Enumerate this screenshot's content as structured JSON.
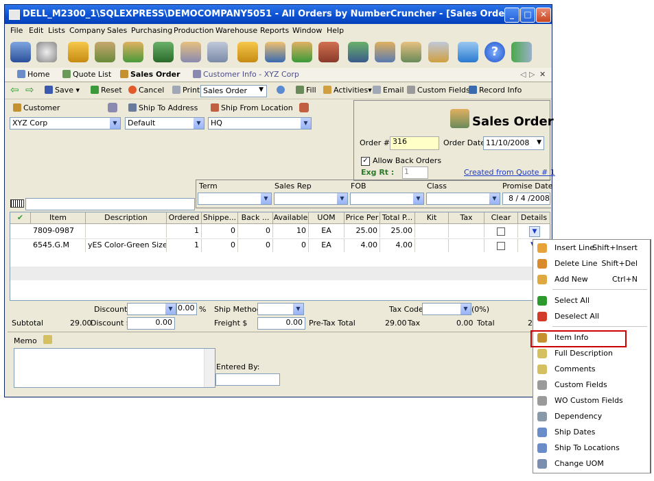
{
  "window": {
    "title": "DELL_M2300_1\\SQLEXPRESS\\DEMOCOMPANY5051 - All Orders by NumberCruncher - [Sales Order]"
  },
  "menu": [
    "File",
    "Edit",
    "Lists",
    "Company",
    "Sales",
    "Purchasing",
    "Production",
    "Warehouse",
    "Reports",
    "Window",
    "Help"
  ],
  "tabs": [
    "Home",
    "Quote List",
    "Sales Order",
    "Customer Info - XYZ Corp"
  ],
  "toolbar": {
    "save": "Save",
    "reset": "Reset",
    "cancel": "Cancel",
    "print": "Print",
    "print_select": "Sales Order",
    "fill": "Fill",
    "activities": "Activities",
    "email": "Email",
    "custom_fields": "Custom Fields",
    "record_info": "Record Info"
  },
  "header": {
    "customer_label": "Customer",
    "ship_to_label": "Ship To Address",
    "ship_from_label": "Ship From Location",
    "customer_value": "XYZ Corp",
    "ship_to_value": "Default",
    "ship_from_value": "HQ"
  },
  "order": {
    "title": "Sales Order",
    "order_no_label": "Order #",
    "order_no": "316",
    "order_date_label": "Order Date",
    "order_date": "11/10/2008",
    "allow_back_orders": "Allow Back Orders",
    "exg_rt_label": "Exg Rt :",
    "exg_rt": "1",
    "created_from": "Created from Quote # 1"
  },
  "terms": {
    "term_label": "Term",
    "rep_label": "Sales Rep",
    "fob_label": "FOB",
    "class_label": "Class",
    "promise_label": "Promise Date",
    "promise_date": "8 / 4 /2008"
  },
  "grid": {
    "headers": [
      "Item",
      "Description",
      "Ordered",
      "Shippe...",
      "Back ...",
      "Available",
      "UOM",
      "Price Per",
      "Total P...",
      "Kit",
      "Tax",
      "Clear",
      "Details"
    ],
    "rows": [
      [
        "7809-0987",
        "",
        "1",
        "0",
        "0",
        "10",
        "EA",
        "25.00",
        "25.00",
        "",
        "",
        "",
        ""
      ],
      [
        "6545.G.M",
        "yES Color-Green Size-...",
        "1",
        "0",
        "0",
        "0",
        "EA",
        "4.00",
        "4.00",
        "",
        "",
        "",
        ""
      ]
    ]
  },
  "footer": {
    "discount_label": "Discount",
    "pct": "0.00",
    "pct_sign": "%",
    "ship_method_label": "Ship Method",
    "tax_code_label": "Tax Code",
    "tax_pct": "(0%)",
    "subtotal_label": "Subtotal",
    "subtotal": "29.00",
    "discount_dollar_label": "Discount $",
    "discount_dollar": "0.00",
    "freight_label": "Freight $",
    "freight": "0.00",
    "pretax_label": "Pre-Tax Total",
    "pretax": "29.00",
    "tax_label": "Tax",
    "tax": "0.00",
    "total_label": "Total",
    "total": "2",
    "memo_label": "Memo",
    "entered_by_label": "Entered By:"
  },
  "context_menu": [
    {
      "label": "Insert Line",
      "shortcut": "Shift+Insert",
      "icon": "insert-line-icon",
      "color": "#e8a23a"
    },
    {
      "label": "Delete Line",
      "shortcut": "Shift+Del",
      "icon": "delete-line-icon",
      "color": "#d98a2a"
    },
    {
      "label": "Add New",
      "shortcut": "Ctrl+N",
      "icon": "add-new-icon",
      "color": "#e0a840"
    },
    {
      "label": "Select All",
      "shortcut": "",
      "icon": "check-icon",
      "color": "#2e9a2e"
    },
    {
      "label": "Deselect All",
      "shortcut": "",
      "icon": "x-icon",
      "color": "#d23b2a"
    },
    {
      "label": "Item Info",
      "shortcut": "",
      "icon": "item-info-icon",
      "color": "#c49030"
    },
    {
      "label": "Full Description",
      "shortcut": "",
      "icon": "note-icon",
      "color": "#d4c060"
    },
    {
      "label": "Comments",
      "shortcut": "",
      "icon": "comments-icon",
      "color": "#d4c060"
    },
    {
      "label": "Custom Fields",
      "shortcut": "",
      "icon": "wrench-icon",
      "color": "#9a9a9a"
    },
    {
      "label": "WO Custom Fields",
      "shortcut": "",
      "icon": "wrench-icon",
      "color": "#9a9a9a"
    },
    {
      "label": "Dependency",
      "shortcut": "",
      "icon": "link-icon",
      "color": "#8899aa"
    },
    {
      "label": "Ship Dates",
      "shortcut": "",
      "icon": "calendar-icon",
      "color": "#6a8cc8"
    },
    {
      "label": "Ship To Locations",
      "shortcut": "",
      "icon": "list-icon",
      "color": "#6a8cc8"
    },
    {
      "label": "Change UOM",
      "shortcut": "",
      "icon": "uom-icon",
      "color": "#7a8fb0"
    }
  ],
  "highlight_color": "#cc0000"
}
